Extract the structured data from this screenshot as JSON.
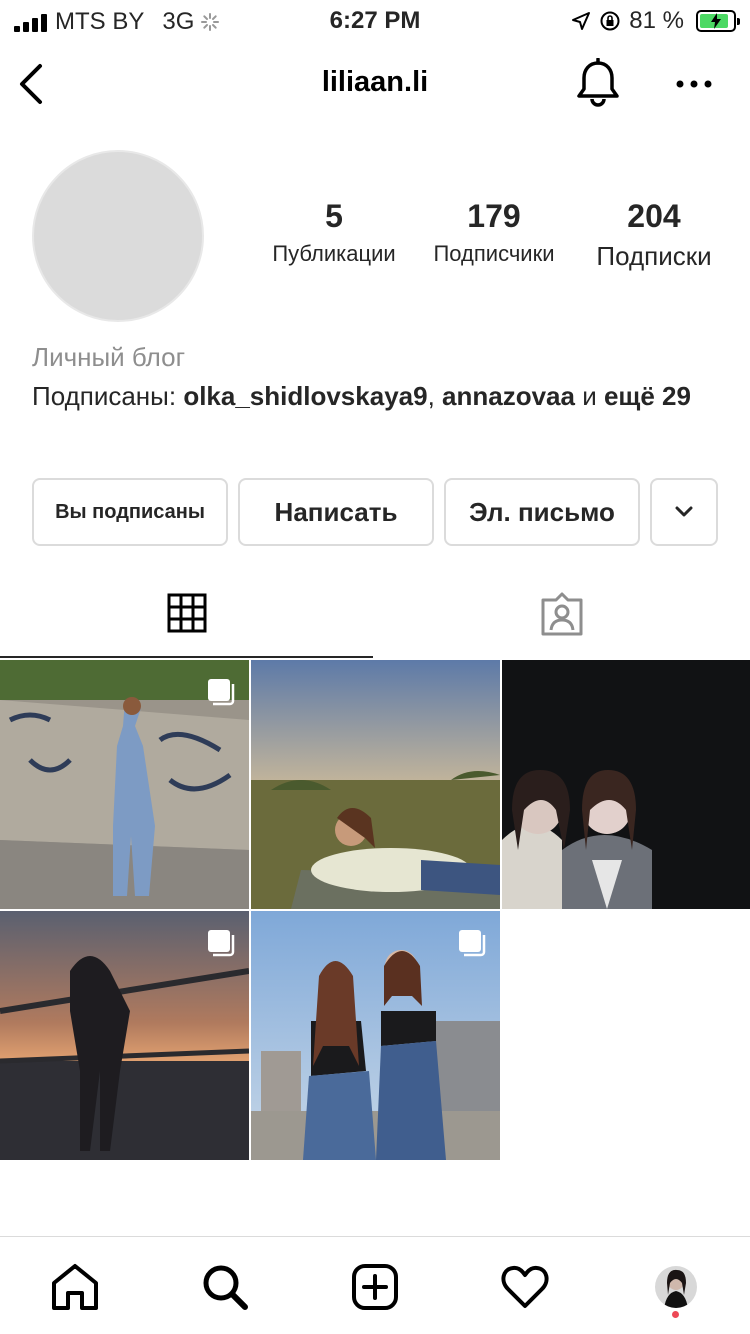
{
  "status_bar": {
    "carrier": "MTS BY",
    "network": "3G",
    "time": "6:27 PM",
    "battery_percent": "81 %",
    "battery_level": 0.81
  },
  "header": {
    "username": "liliaan.li",
    "icons": [
      "back-chevron-icon",
      "bell-icon",
      "more-dots-icon"
    ]
  },
  "profile": {
    "stats": [
      {
        "value": "5",
        "label": "Публикации"
      },
      {
        "value": "179",
        "label": "Подписчики"
      },
      {
        "value": "204",
        "label": "Подписки"
      }
    ],
    "category": "Личный блог",
    "followed_by": {
      "prefix": "Подписаны: ",
      "user1": "olka_shidlovskaya9",
      "separator": ", ",
      "user2": "annazovaa",
      "conjunction": " и ",
      "more": "ещё 29"
    }
  },
  "actions": {
    "following_label": "Вы подписаны",
    "message_label": "Написать",
    "email_label": "Эл. письмо",
    "dropdown_icon": "chevron-down-icon"
  },
  "tabs": [
    {
      "icon": "grid-icon",
      "active": true
    },
    {
      "icon": "tagged-person-icon",
      "active": false
    }
  ],
  "posts": [
    {
      "description": "girl in jeans by graffiti wall",
      "multi": true
    },
    {
      "description": "girl lying on grass at sunset",
      "multi": false
    },
    {
      "description": "two girls at night",
      "multi": false
    },
    {
      "description": "silhouette at sunset by railing",
      "multi": true
    },
    {
      "description": "two girls on rooftop",
      "multi": true
    }
  ],
  "bottom_nav": [
    "home-icon",
    "search-icon",
    "new-post-icon",
    "activity-heart-icon",
    "profile-avatar"
  ],
  "colors": {
    "text": "#262626",
    "muted": "#8e8e8e",
    "border": "#dbdbdb",
    "notification_dot": "#ed4956",
    "battery": "#4cd964"
  }
}
